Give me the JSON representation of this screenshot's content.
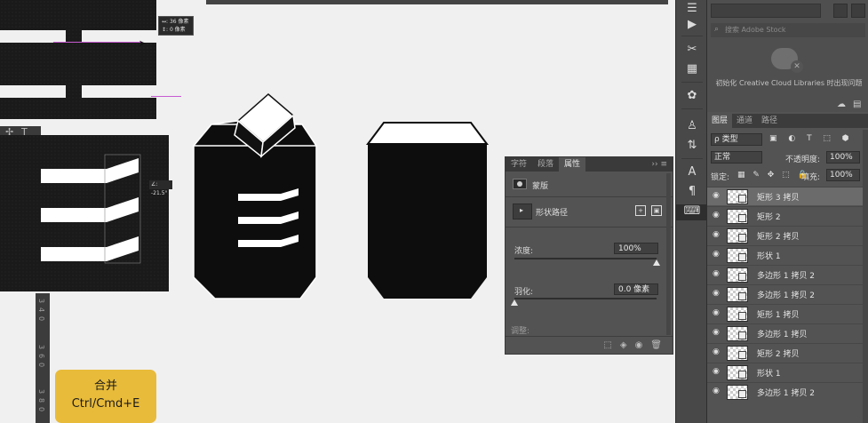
{
  "canvas": {
    "measure_tip": {
      "width": "↔: 36 像素",
      "height": "↕: 0 像素"
    },
    "angle_tip": "∠: -21.5°",
    "ruler_numbers": [
      "3",
      "4",
      "0",
      "3",
      "6",
      "0",
      "3",
      "8",
      "0"
    ]
  },
  "left_tools": {
    "icons": [
      "✢",
      "T"
    ]
  },
  "shortcut_badge": {
    "line1": "合并",
    "line2": "Ctrl/Cmd+E",
    "color": "#e8bb3a"
  },
  "properties_panel": {
    "tabs": [
      "字符",
      "段落",
      "属性"
    ],
    "active_tab": "属性",
    "menu_glyph": "›› ≡",
    "mask_label": "蒙版",
    "vector_mask_label": "形状路径",
    "density_label": "浓度:",
    "density_value": "100%",
    "density_fraction": 1.0,
    "feather_label": "羽化:",
    "feather_value": "0.0 像素",
    "feather_fraction": 0.0,
    "refine_label": "调整:",
    "footer_icons": [
      "⬚",
      "◈",
      "◉",
      "🗑"
    ]
  },
  "tool_strip": {
    "icons": [
      "☰",
      "▶",
      "✂",
      "▦",
      "✿",
      "♙",
      "⇅",
      "A",
      "¶",
      "⌨"
    ],
    "selected_index": 9
  },
  "libraries_panel": {
    "search_placeholder": "搜索 Adobe Stock",
    "message": "初始化 Creative Cloud Libraries 时出现问题"
  },
  "layers_panel": {
    "tabs": [
      "图层",
      "通道",
      "路径"
    ],
    "active_tab": "图层",
    "filter_label": "ρ 类型",
    "filter_icons": "▣ ◐ T ⬚ ⬢",
    "blend_mode": "正常",
    "opacity_label": "不透明度:",
    "opacity_value": "100%",
    "lock_label": "锁定:",
    "lock_icons": "▦ ✎ ✥ ⬚ 🔒",
    "fill_label": "填充:",
    "fill_value": "100%",
    "layers": [
      {
        "name": "矩形 3 拷贝",
        "selected": true
      },
      {
        "name": "矩形 2",
        "selected": false
      },
      {
        "name": "矩形 2 拷贝",
        "selected": false
      },
      {
        "name": "形状 1",
        "selected": false
      },
      {
        "name": "多边形 1 拷贝 2",
        "selected": false
      },
      {
        "name": "多边形 1 拷贝 2",
        "selected": false
      },
      {
        "name": "矩形 1 拷贝",
        "selected": false
      },
      {
        "name": "多边形 1 拷贝",
        "selected": false
      },
      {
        "name": "矩形 2 拷贝",
        "selected": false
      },
      {
        "name": "形状 1",
        "selected": false
      },
      {
        "name": "多边形 1 拷贝 2",
        "selected": false
      }
    ]
  }
}
